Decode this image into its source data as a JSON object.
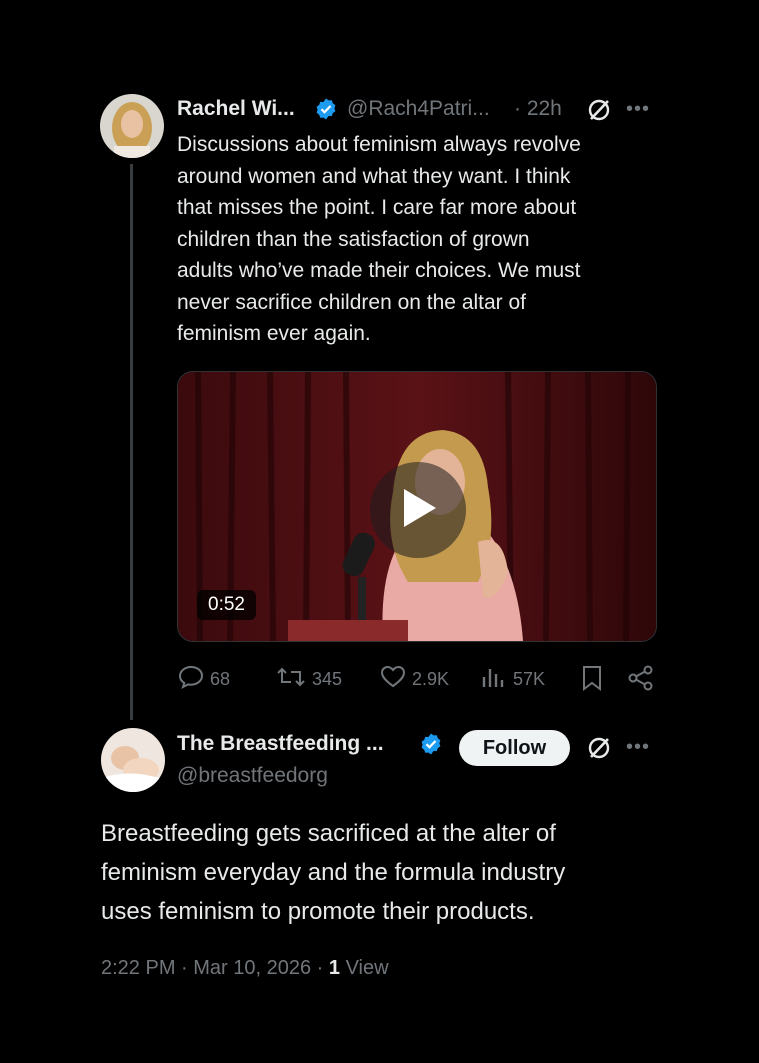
{
  "tweet": {
    "author_name": "Rachel Wi...",
    "handle": "@Rach4Patri...",
    "time": "· 22h",
    "body_lines": [
      "Discussions about feminism always revolve",
      "around women and what they want. I think",
      "that misses the point. I care far more about",
      "children than the satisfaction of grown",
      "adults who’ve made their choices. We must",
      "never sacrifice children on the altar of",
      "feminism ever again."
    ],
    "video": {
      "duration": "0:52"
    },
    "actions": {
      "replies": "68",
      "reposts": "345",
      "likes": "2.9K",
      "views": "57K"
    }
  },
  "reply": {
    "author_name": "The Breastfeeding ...",
    "handle": "@breastfeedorg",
    "follow_label": "Follow",
    "body_lines": [
      "Breastfeeding gets sacrificed at the alter of",
      "feminism everyday and the formula industry",
      "uses feminism to promote their products."
    ],
    "timestamp": "2:22 PM · Mar 10, 2026 · ",
    "views_count": "1",
    "views_label": "View"
  },
  "icons": {
    "verified": "verified-badge-icon",
    "grok": "grok-icon",
    "more": "more-icon",
    "reply": "reply-icon",
    "repost": "repost-icon",
    "like": "heart-icon",
    "views": "views-icon",
    "bookmark": "bookmark-icon",
    "share": "share-icon",
    "play": "play-icon"
  },
  "colors": {
    "verified": "#1d9bf0",
    "muted": "#71767b",
    "text": "#e7e9ea",
    "background": "#000000"
  }
}
